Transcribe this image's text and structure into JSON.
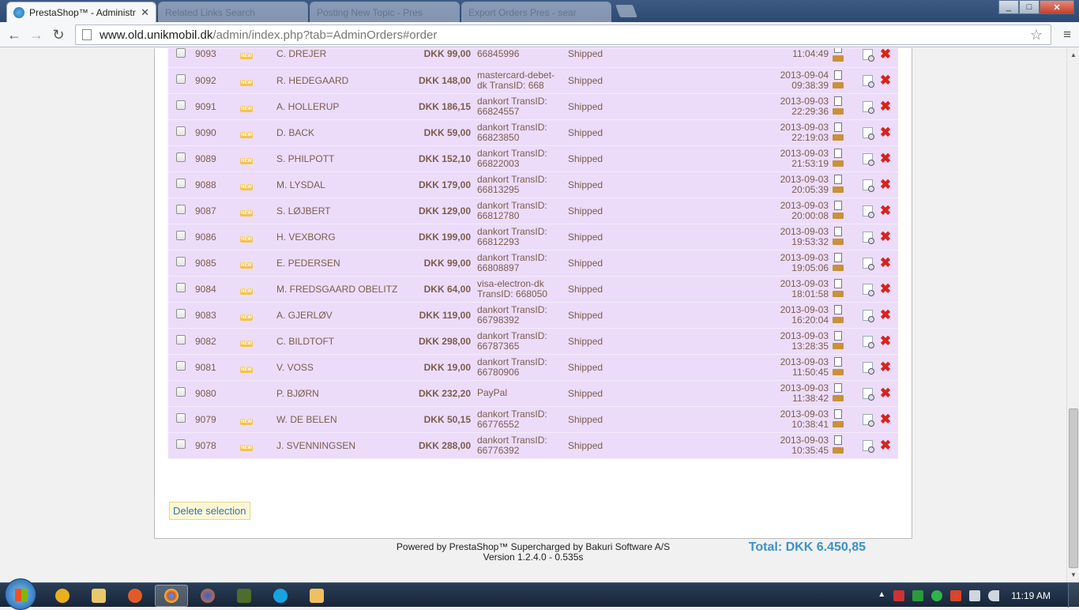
{
  "browser": {
    "active_tab_title": "PrestaShop™ - Administra",
    "inactive_tabs": [
      "Related Links Search",
      "Posting New Topic - Pres",
      "Export Orders Pres - sear"
    ],
    "url_host": "www.old.unikmobil.dk",
    "url_path": "/admin/index.php?tab=AdminOrders#order"
  },
  "orders": [
    {
      "id": "9093",
      "new": true,
      "customer": "C. DREJER",
      "total": "DKK 99,00",
      "payment_l1": "",
      "payment_l2": "66845996",
      "state": "Shipped",
      "date": "",
      "time": "11:04:49"
    },
    {
      "id": "9092",
      "new": true,
      "customer": "R. HEDEGAARD",
      "total": "DKK 148,00",
      "payment_l1": "mastercard-debet-",
      "payment_l2": "dk TransID: 668",
      "state": "Shipped",
      "date": "2013-09-04",
      "time": "09:38:39"
    },
    {
      "id": "9091",
      "new": true,
      "customer": "A. HOLLERUP",
      "total": "DKK 186,15",
      "payment_l1": "dankort TransID:",
      "payment_l2": "66824557",
      "state": "Shipped",
      "date": "2013-09-03",
      "time": "22:29:36"
    },
    {
      "id": "9090",
      "new": true,
      "customer": "D. BACK",
      "total": "DKK 59,00",
      "payment_l1": "dankort TransID:",
      "payment_l2": "66823850",
      "state": "Shipped",
      "date": "2013-09-03",
      "time": "22:19:03"
    },
    {
      "id": "9089",
      "new": true,
      "customer": "S. PHILPOTT",
      "total": "DKK 152,10",
      "payment_l1": "dankort TransID:",
      "payment_l2": "66822003",
      "state": "Shipped",
      "date": "2013-09-03",
      "time": "21:53:19"
    },
    {
      "id": "9088",
      "new": true,
      "customer": "M. LYSDAL",
      "total": "DKK 179,00",
      "payment_l1": "dankort TransID:",
      "payment_l2": "66813295",
      "state": "Shipped",
      "date": "2013-09-03",
      "time": "20:05:39"
    },
    {
      "id": "9087",
      "new": true,
      "customer": "S. LØJBERT",
      "total": "DKK 129,00",
      "payment_l1": "dankort TransID:",
      "payment_l2": "66812780",
      "state": "Shipped",
      "date": "2013-09-03",
      "time": "20:00:08"
    },
    {
      "id": "9086",
      "new": true,
      "customer": "H. VEXBORG",
      "total": "DKK 199,00",
      "payment_l1": "dankort TransID:",
      "payment_l2": "66812293",
      "state": "Shipped",
      "date": "2013-09-03",
      "time": "19:53:32"
    },
    {
      "id": "9085",
      "new": true,
      "customer": "E. PEDERSEN",
      "total": "DKK 99,00",
      "payment_l1": "dankort TransID:",
      "payment_l2": "66808897",
      "state": "Shipped",
      "date": "2013-09-03",
      "time": "19:05:06"
    },
    {
      "id": "9084",
      "new": true,
      "customer": "M. FREDSGAARD OBELITZ",
      "total": "DKK 64,00",
      "payment_l1": "visa-electron-dk",
      "payment_l2": "TransID: 668050",
      "state": "Shipped",
      "date": "2013-09-03",
      "time": "18:01:58"
    },
    {
      "id": "9083",
      "new": true,
      "customer": "A. GJERLØV",
      "total": "DKK 119,00",
      "payment_l1": "dankort TransID:",
      "payment_l2": "66798392",
      "state": "Shipped",
      "date": "2013-09-03",
      "time": "16:20:04"
    },
    {
      "id": "9082",
      "new": true,
      "customer": "C. BILDTOFT",
      "total": "DKK 298,00",
      "payment_l1": "dankort TransID:",
      "payment_l2": "66787365",
      "state": "Shipped",
      "date": "2013-09-03",
      "time": "13:28:35"
    },
    {
      "id": "9081",
      "new": true,
      "customer": "V. VOSS",
      "total": "DKK 19,00",
      "payment_l1": "dankort TransID:",
      "payment_l2": "66780906",
      "state": "Shipped",
      "date": "2013-09-03",
      "time": "11:50:45"
    },
    {
      "id": "9080",
      "new": false,
      "customer": "P. BJØRN",
      "total": "DKK 232,20",
      "payment_l1": "PayPal",
      "payment_l2": "",
      "state": "Shipped",
      "date": "2013-09-03",
      "time": "11:38:42"
    },
    {
      "id": "9079",
      "new": true,
      "customer": "W. DE BELEN",
      "total": "DKK 50,15",
      "payment_l1": "dankort TransID:",
      "payment_l2": "66776552",
      "state": "Shipped",
      "date": "2013-09-03",
      "time": "10:38:41"
    },
    {
      "id": "9078",
      "new": true,
      "customer": "J. SVENNINGSEN",
      "total": "DKK 288,00",
      "payment_l1": "dankort TransID:",
      "payment_l2": "66776392",
      "state": "Shipped",
      "date": "2013-09-03",
      "time": "10:35:45"
    }
  ],
  "actions": {
    "delete_selection": "Delete selection"
  },
  "summary": {
    "total": "Total: DKK 6.450,85"
  },
  "footer": {
    "line1": "Powered by PrestaShop™  Supercharged by Bakuri Software A/S",
    "line2": "Version 1.2.4.0 - 0.535s"
  },
  "taskbar": {
    "clock": "11:19 AM"
  },
  "colors": {
    "row_background": "#ecdcfa",
    "row_text": "#7b5c4c",
    "total_text": "#3c92c8",
    "delete_icon": "#d8231c"
  }
}
